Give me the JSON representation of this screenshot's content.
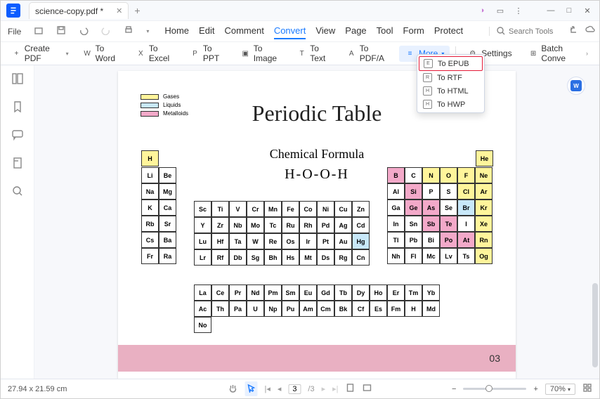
{
  "titlebar": {
    "filename": "science-copy.pdf *"
  },
  "menu": {
    "file": "File",
    "tabs": [
      "Home",
      "Edit",
      "Comment",
      "Convert",
      "View",
      "Page",
      "Tool",
      "Form",
      "Protect"
    ],
    "active": "Convert",
    "search_placeholder": "Search Tools"
  },
  "toolbar": {
    "create": "Create PDF",
    "word": "To Word",
    "excel": "To Excel",
    "ppt": "To PPT",
    "image": "To Image",
    "text": "To Text",
    "pdfa": "To PDF/A",
    "more": "More",
    "settings": "Settings",
    "batch": "Batch Conve"
  },
  "dropdown": {
    "items": [
      {
        "icon": "E",
        "label": "To EPUB"
      },
      {
        "icon": "R",
        "label": "To RTF"
      },
      {
        "icon": "H",
        "label": "To HTML"
      },
      {
        "icon": "H",
        "label": "To HWP"
      }
    ],
    "highlight": 0
  },
  "doc": {
    "title": "Periodic Table",
    "subtitle": "Chemical Formula",
    "formula": "H-O-O-H",
    "legend": {
      "g": "Gases",
      "l": "Liquids",
      "m": "Metalloids"
    },
    "pagenum": "03"
  },
  "elements": {
    "block1": [
      [
        "H",
        "gas"
      ]
    ],
    "block2": [
      [
        "Li",
        ""
      ],
      [
        "Be",
        ""
      ],
      [
        "Na",
        ""
      ],
      [
        "Mg",
        ""
      ],
      [
        "K",
        ""
      ],
      [
        "Ca",
        ""
      ],
      [
        "Rb",
        ""
      ],
      [
        "Sr",
        ""
      ],
      [
        "Cs",
        ""
      ],
      [
        "Ba",
        ""
      ],
      [
        "Fr",
        ""
      ],
      [
        "Ra",
        ""
      ]
    ],
    "block3": [
      [
        "Sc",
        ""
      ],
      [
        "Ti",
        ""
      ],
      [
        "V",
        ""
      ],
      [
        "Cr",
        ""
      ],
      [
        "Mn",
        ""
      ],
      [
        "Fe",
        ""
      ],
      [
        "Co",
        ""
      ],
      [
        "Ni",
        ""
      ],
      [
        "Cu",
        ""
      ],
      [
        "Zn",
        ""
      ],
      [
        "Y",
        ""
      ],
      [
        "Zr",
        ""
      ],
      [
        "Nb",
        ""
      ],
      [
        "Mo",
        ""
      ],
      [
        "Tc",
        ""
      ],
      [
        "Ru",
        ""
      ],
      [
        "Rh",
        ""
      ],
      [
        "Pd",
        ""
      ],
      [
        "Ag",
        ""
      ],
      [
        "Cd",
        ""
      ],
      [
        "Lu",
        ""
      ],
      [
        "Hf",
        ""
      ],
      [
        "Ta",
        ""
      ],
      [
        "W",
        ""
      ],
      [
        "Re",
        ""
      ],
      [
        "Os",
        ""
      ],
      [
        "Ir",
        ""
      ],
      [
        "Pt",
        ""
      ],
      [
        "Au",
        ""
      ],
      [
        "Hg",
        "liq"
      ],
      [
        "Lr",
        ""
      ],
      [
        "Rf",
        ""
      ],
      [
        "Db",
        ""
      ],
      [
        "Sg",
        ""
      ],
      [
        "Bh",
        ""
      ],
      [
        "Hs",
        ""
      ],
      [
        "Mt",
        ""
      ],
      [
        "Ds",
        ""
      ],
      [
        "Rg",
        ""
      ],
      [
        "Cn",
        ""
      ]
    ],
    "block4": [
      [
        "B",
        "met"
      ],
      [
        "C",
        ""
      ],
      [
        "N",
        "gas"
      ],
      [
        "O",
        "gas"
      ],
      [
        "F",
        "gas"
      ],
      [
        "Ne",
        "gas"
      ],
      [
        "Al",
        ""
      ],
      [
        "Si",
        "met"
      ],
      [
        "P",
        ""
      ],
      [
        "S",
        ""
      ],
      [
        "Cl",
        "gas"
      ],
      [
        "Ar",
        "gas"
      ],
      [
        "Ga",
        ""
      ],
      [
        "Ge",
        "met"
      ],
      [
        "As",
        "met"
      ],
      [
        "Se",
        ""
      ],
      [
        "Br",
        "liq"
      ],
      [
        "Kr",
        "gas"
      ],
      [
        "In",
        ""
      ],
      [
        "Sn",
        ""
      ],
      [
        "Sb",
        "met"
      ],
      [
        "Te",
        "met"
      ],
      [
        "I",
        ""
      ],
      [
        "Xe",
        "gas"
      ],
      [
        "Tl",
        ""
      ],
      [
        "Pb",
        ""
      ],
      [
        "Bi",
        ""
      ],
      [
        "Po",
        "met"
      ],
      [
        "At",
        "met"
      ],
      [
        "Rn",
        "gas"
      ],
      [
        "Nh",
        ""
      ],
      [
        "Fl",
        ""
      ],
      [
        "Mc",
        ""
      ],
      [
        "Lv",
        ""
      ],
      [
        "Ts",
        ""
      ],
      [
        "Og",
        "gas"
      ]
    ],
    "he": [
      "He",
      "gas"
    ],
    "lan": [
      [
        "La",
        ""
      ],
      [
        "Ce",
        ""
      ],
      [
        "Pr",
        ""
      ],
      [
        "Nd",
        ""
      ],
      [
        "Pm",
        ""
      ],
      [
        "Sm",
        ""
      ],
      [
        "Eu",
        ""
      ],
      [
        "Gd",
        ""
      ],
      [
        "Tb",
        ""
      ],
      [
        "Dy",
        ""
      ],
      [
        "Ho",
        ""
      ],
      [
        "Er",
        ""
      ],
      [
        "Tm",
        ""
      ],
      [
        "Yb",
        ""
      ],
      [
        "Ac",
        ""
      ],
      [
        "Th",
        ""
      ],
      [
        "Pa",
        ""
      ],
      [
        "U",
        ""
      ],
      [
        "Np",
        ""
      ],
      [
        "Pu",
        ""
      ],
      [
        "Am",
        ""
      ],
      [
        "Cm",
        ""
      ],
      [
        "Bk",
        ""
      ],
      [
        "Cf",
        ""
      ],
      [
        "Es",
        ""
      ],
      [
        "Fm",
        ""
      ],
      [
        "H",
        ""
      ],
      [
        "Md",
        ""
      ],
      [
        "No",
        ""
      ]
    ]
  },
  "status": {
    "dims": "27.94 x 21.59 cm",
    "page": "3",
    "total": "/3",
    "zoom": "70%"
  }
}
